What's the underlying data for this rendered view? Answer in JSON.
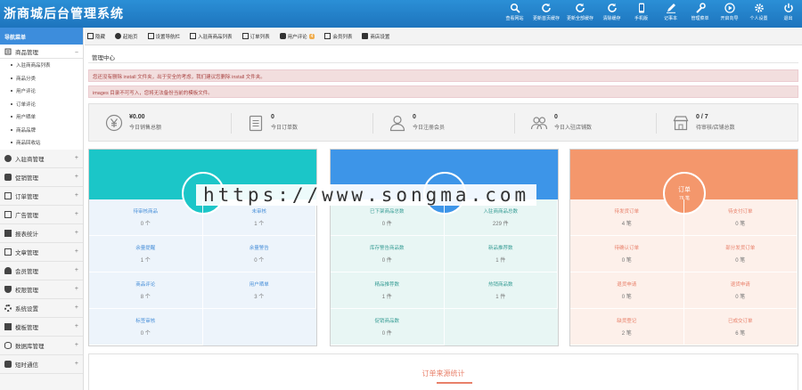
{
  "app": {
    "title": "浙商城后台管理系统"
  },
  "topnav": [
    {
      "label": "查看网站",
      "icon": "search-icon"
    },
    {
      "label": "更新首页缓存",
      "icon": "refresh-icon"
    },
    {
      "label": "更新全部缓存",
      "icon": "refresh-icon"
    },
    {
      "label": "清除缓存",
      "icon": "refresh-icon"
    },
    {
      "label": "手机版",
      "icon": "mobile-icon"
    },
    {
      "label": "记事本",
      "icon": "notepad-icon"
    },
    {
      "label": "管理菜单",
      "icon": "wrench-icon"
    },
    {
      "label": "开启向导",
      "icon": "play-icon"
    },
    {
      "label": "个人设置",
      "icon": "gear-icon"
    },
    {
      "label": "退出",
      "icon": "power-icon"
    }
  ],
  "sidebar": {
    "header": "导航菜单",
    "open_group": {
      "label": "商品管理",
      "toggle": "−",
      "items": [
        "入驻商商品列表",
        "商品分类",
        "用户评论",
        "订单评论",
        "用户晒单",
        "商品品牌",
        "商品回收站"
      ]
    },
    "groups": [
      {
        "label": "入驻商管理",
        "icon": "store-icon"
      },
      {
        "label": "促销管理",
        "icon": "tag-icon"
      },
      {
        "label": "订单管理",
        "icon": "order-icon"
      },
      {
        "label": "广告管理",
        "icon": "ad-icon"
      },
      {
        "label": "报表统计",
        "icon": "chart-icon"
      },
      {
        "label": "文章管理",
        "icon": "article-icon"
      },
      {
        "label": "会员管理",
        "icon": "users-icon"
      },
      {
        "label": "权限管理",
        "icon": "shield-icon"
      },
      {
        "label": "系统设置",
        "icon": "gears-icon"
      },
      {
        "label": "模板管理",
        "icon": "template-icon"
      },
      {
        "label": "数据库管理",
        "icon": "database-icon"
      },
      {
        "label": "短时通信",
        "icon": "message-icon"
      }
    ],
    "expand_symbol": "+"
  },
  "toolbar": [
    {
      "label": "隐藏",
      "icon": "hide-icon"
    },
    {
      "label": "起始页",
      "icon": "home-icon"
    },
    {
      "label": "设置导航栏",
      "icon": "settings-icon"
    },
    {
      "label": "入驻商商品列表",
      "icon": "list-icon"
    },
    {
      "label": "订单列表",
      "icon": "list-icon"
    },
    {
      "label": "用户评论",
      "icon": "comment-icon",
      "badge": "4"
    },
    {
      "label": "会员列表",
      "icon": "member-icon"
    },
    {
      "label": "商店设置",
      "icon": "shop-icon"
    }
  ],
  "breadcrumb": "管理中心",
  "alerts": [
    "您还没有删除 install 文件夹，出于安全的考虑，我们建议您删除 install 文件夹。",
    "images 目录不可写入，您将无法备份当前的模板文件。"
  ],
  "stats": [
    {
      "value": "¥0.00",
      "label": "今日销售总额",
      "icon": "yen-icon"
    },
    {
      "value": "0",
      "label": "今日订单数",
      "icon": "clipboard-icon"
    },
    {
      "value": "0",
      "label": "今日注册会员",
      "icon": "user-icon"
    },
    {
      "value": "0",
      "label": "今日入驻店铺数",
      "icon": "group-icon"
    },
    {
      "value": "0 / 7",
      "label": "待审核/店铺总数",
      "icon": "shop-icon"
    }
  ],
  "panels": [
    {
      "color": "#1bc6c8",
      "bg": "#edf4fb",
      "label_color": "#4a90d9",
      "head": "",
      "head_sub": "",
      "cells": [
        {
          "l": "待审核商品",
          "v": "0 个"
        },
        {
          "l": "未审核",
          "v": "1 个"
        },
        {
          "l": "余量提醒",
          "v": "1 个"
        },
        {
          "l": "余量警告",
          "v": "0 个"
        },
        {
          "l": "商品评论",
          "v": "8 个"
        },
        {
          "l": "用户晒单",
          "v": "3 个"
        },
        {
          "l": "标签审核",
          "v": "0 个"
        }
      ]
    },
    {
      "color": "#3d95e8",
      "bg": "#e8f6f4",
      "label_color": "#3a9e96",
      "head": "",
      "head_sub": "",
      "cells": [
        {
          "l": "已下架商品总数",
          "v": "0 件"
        },
        {
          "l": "入驻商商品总数",
          "v": "229 件"
        },
        {
          "l": "库存警告商品数",
          "v": "0 件"
        },
        {
          "l": "新品推荐数",
          "v": "1 件"
        },
        {
          "l": "精品推荐数",
          "v": "1 件"
        },
        {
          "l": "热销商品数",
          "v": "1 件"
        },
        {
          "l": "促销商品数",
          "v": "0 件"
        }
      ]
    },
    {
      "color": "#f4976c",
      "bg": "#fdf0ea",
      "label_color": "#e8806a",
      "head": "订单",
      "head_sub": "76 笔",
      "cells": [
        {
          "l": "待发货订单",
          "v": "4 笔"
        },
        {
          "l": "待支付订单",
          "v": "0 笔"
        },
        {
          "l": "待确认订单",
          "v": "0 笔"
        },
        {
          "l": "部分发货订单",
          "v": "0 笔"
        },
        {
          "l": "退货申请",
          "v": "0 笔"
        },
        {
          "l": "退货申请",
          "v": "0 笔"
        },
        {
          "l": "缺货登记",
          "v": "2 笔"
        },
        {
          "l": "已成交订单",
          "v": "6 笔"
        }
      ]
    }
  ],
  "bottom": {
    "title": "订单来源统计"
  },
  "watermark": "https://www.songma.com"
}
